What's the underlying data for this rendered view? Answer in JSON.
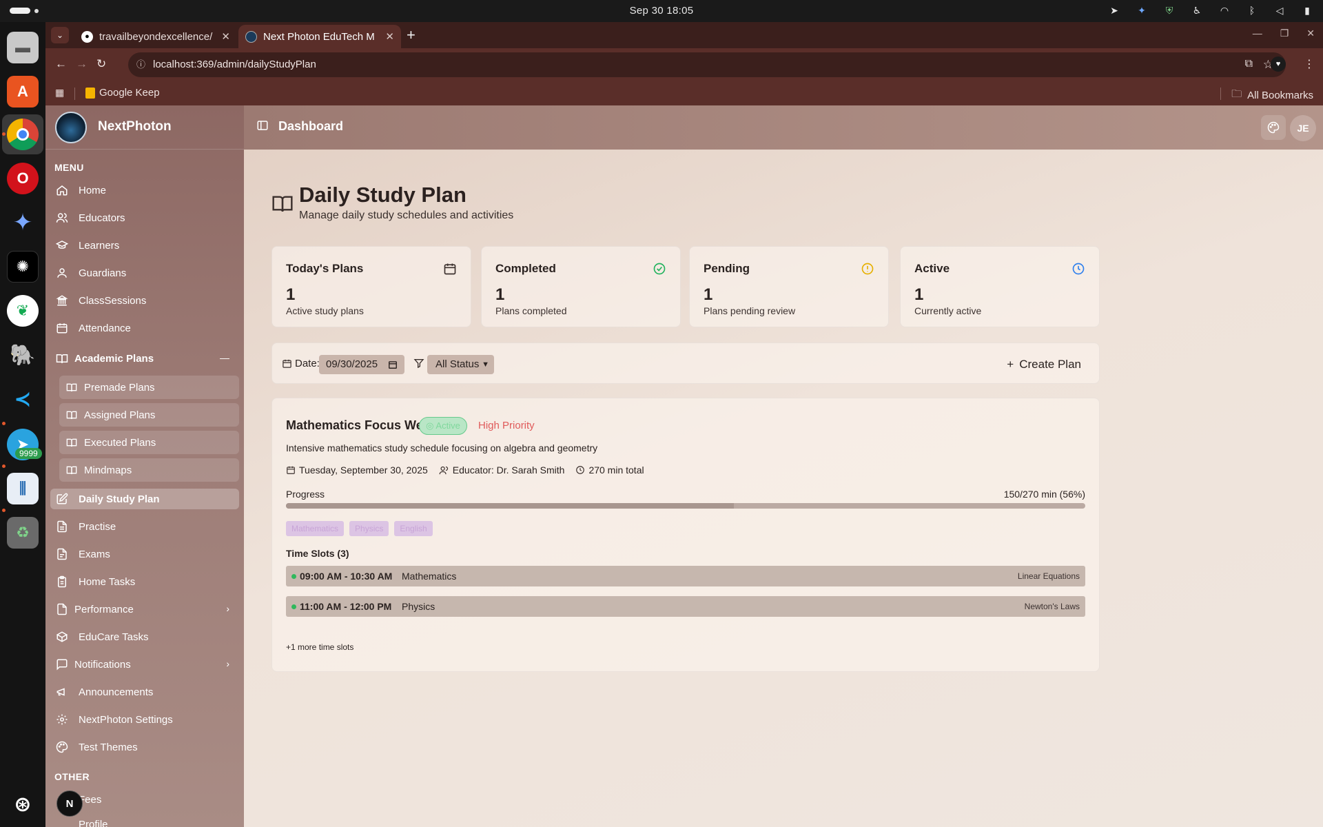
{
  "os": {
    "clock": "Sep 30  18:05"
  },
  "dock": {
    "telegram_badge": "9999"
  },
  "browser": {
    "tabs": [
      {
        "label": "travailbeyondexcellence/",
        "favicon": "github-icon"
      },
      {
        "label": "Next Photon EduTech M",
        "favicon": "nextphoton-icon"
      }
    ],
    "url": "localhost:369/admin/dailyStudyPlan",
    "bookmarks": {
      "keep_label": "Google Keep",
      "all_label": "All Bookmarks"
    }
  },
  "sidebar": {
    "brand": "NextPhoton",
    "menu_label": "MENU",
    "other_label": "OTHER",
    "items": [
      {
        "label": "Home",
        "icon": "home-icon"
      },
      {
        "label": "Educators",
        "icon": "users-icon"
      },
      {
        "label": "Learners",
        "icon": "graduation-cap-icon"
      },
      {
        "label": "Guardians",
        "icon": "user-icon"
      },
      {
        "label": "ClassSessions",
        "icon": "building-icon"
      },
      {
        "label": "Attendance",
        "icon": "calendar-icon"
      }
    ],
    "academic_group": {
      "label": "Academic Plans",
      "subitems": [
        {
          "label": "Premade Plans"
        },
        {
          "label": "Assigned Plans"
        },
        {
          "label": "Executed Plans"
        },
        {
          "label": "Mindmaps"
        }
      ]
    },
    "items_after": [
      {
        "label": "Daily Study Plan",
        "icon": "edit-icon",
        "selected": true
      },
      {
        "label": "Practise",
        "icon": "file-icon"
      },
      {
        "label": "Exams",
        "icon": "file-text-icon"
      },
      {
        "label": "Home Tasks",
        "icon": "clipboard-icon"
      },
      {
        "label": "Performance",
        "icon": "file-icon"
      },
      {
        "label": "EduCare Tasks",
        "icon": "box-icon"
      },
      {
        "label": "Notifications",
        "icon": "message-icon"
      },
      {
        "label": "Announcements",
        "icon": "megaphone-icon"
      },
      {
        "label": "NextPhoton Settings",
        "icon": "gear-icon"
      },
      {
        "label": "Test Themes",
        "icon": "palette-icon"
      }
    ],
    "other_items": [
      {
        "label": "Fees"
      },
      {
        "label": "Profile"
      }
    ]
  },
  "header": {
    "title": "Dashboard",
    "avatar_initials": "JE"
  },
  "page": {
    "title": "Daily Study Plan",
    "subtitle": "Manage daily study schedules and activities"
  },
  "stats": [
    {
      "title": "Today's Plans",
      "value": "1",
      "desc": "Active study plans",
      "icon": "calendar-icon",
      "color": "#3a2f2c"
    },
    {
      "title": "Completed",
      "value": "1",
      "desc": "Plans completed",
      "icon": "check-circle-icon",
      "color": "#22b35e"
    },
    {
      "title": "Pending",
      "value": "1",
      "desc": "Plans pending review",
      "icon": "alert-circle-icon",
      "color": "#e6b000"
    },
    {
      "title": "Active",
      "value": "1",
      "desc": "Currently active",
      "icon": "clock-icon",
      "color": "#2f80ed"
    }
  ],
  "filters": {
    "date_label": "Date:",
    "date_value": "09/30/2025",
    "status_value": "All Status",
    "create_label": "Create Plan"
  },
  "plan": {
    "title": "Mathematics Focus Week",
    "status": "Active",
    "priority": "High Priority",
    "description": "Intensive mathematics study schedule focusing on algebra and geometry",
    "date": "Tuesday, September 30, 2025",
    "educator": "Educator: Dr. Sarah Smith",
    "total": "270 min total",
    "progress_label": "Progress",
    "progress_text": "150/270 min (56%)",
    "progress_fraction": 0.56,
    "subjects": [
      "Mathematics",
      "Physics",
      "English"
    ],
    "slots_title": "Time Slots (3)",
    "slots": [
      {
        "time": "09:00 AM - 10:30 AM",
        "subject": "Mathematics",
        "topic": "Linear Equations"
      },
      {
        "time": "11:00 AM - 12:00 PM",
        "subject": "Physics",
        "topic": "Newton's Laws"
      }
    ],
    "more": "+1 more time slots"
  }
}
